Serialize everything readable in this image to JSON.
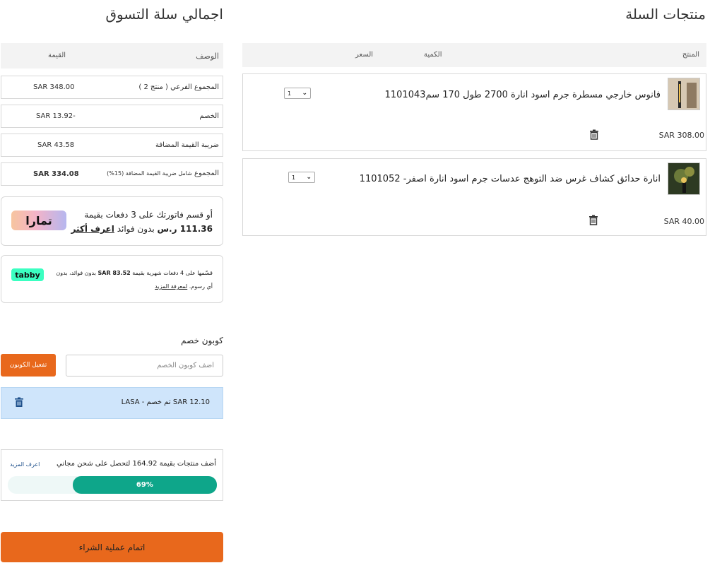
{
  "cart": {
    "title": "منتجات السلة",
    "headers": {
      "product": "المنتج",
      "quantity": "الكمية",
      "price": "السعر"
    },
    "items": [
      {
        "name": "فانوس خارجي مسطرة جرم اسود انارة 2700 طول 170 سم1101043",
        "quantity": "1",
        "price": "SAR 308.00"
      },
      {
        "name": "انارة حدائق كشاف غرس ضد التوهج عدسات جرم اسود انارة اصفر- 1101052",
        "quantity": "1",
        "price": "SAR 40.00"
      }
    ]
  },
  "summary": {
    "title": "اجمالي سلة التسوق",
    "headers": {
      "description": "الوصف",
      "value": "القيمة"
    },
    "subtotal": {
      "label": "المجموع الفرعي ( منتج 2 )",
      "value": "SAR 348.00"
    },
    "discount": {
      "label": "الخصم",
      "value": "SAR 13.92-"
    },
    "vat": {
      "label": "ضريبة القيمة المضافة",
      "value": "SAR 43.58"
    },
    "total": {
      "label": "المجموع",
      "note": "شامل ضريبة القيمة المضافة (15%)",
      "value": "SAR 334.08"
    }
  },
  "tamara": {
    "logo": "تمارا",
    "line1": "أو قسم فاتورتك على 3 دفعات بقيمة",
    "amount": "111.36 ر.س",
    "line2": "بدون فوائد",
    "link": "اعرف أكثر"
  },
  "tabby": {
    "logo": "tabby",
    "text_a": "قسّمها على 4 دفعات شهرية بقيمة",
    "amount": "SAR 83.52",
    "text_b": "بدون فوائد، بدون",
    "text_c": "أي رسوم.",
    "link": "لمعرفة المزيد"
  },
  "coupon": {
    "label": "كوبون خصم",
    "placeholder": "أضف كوبون الخصم",
    "button": "تفعيل الكوبون",
    "applied_text": "LASA - تم خصم SAR 12.10"
  },
  "shipping": {
    "text": "أضف منتجات بقيمة 164.92 لتحصل على شحن مجاني",
    "link": "اعرف المزيد",
    "progress_percent": 69,
    "progress_label": "69%"
  },
  "checkout": {
    "button": "اتمام عملية الشراء"
  },
  "colors": {
    "accent": "#e8681c",
    "progress": "#0ea68a",
    "applied_bg": "#cfe5fb"
  }
}
